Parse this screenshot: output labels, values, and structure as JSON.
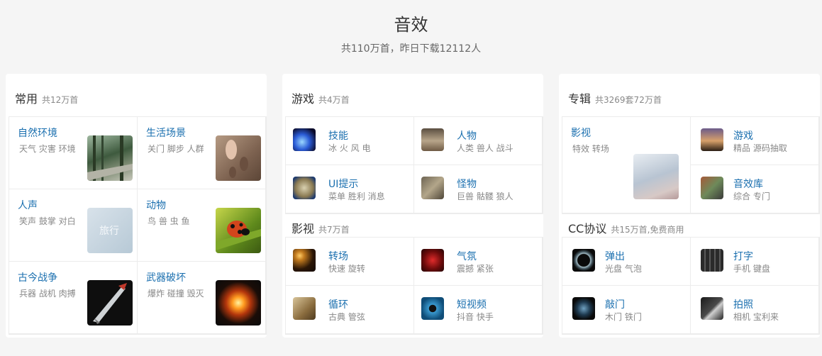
{
  "header": {
    "title": "音效",
    "subtitle": "共110万首，昨日下载12112人"
  },
  "panels": {
    "common": {
      "title": "常用",
      "count": "共12万首",
      "items": [
        {
          "title": "自然环境",
          "sub": "天气 灾害 环境",
          "icon": "forest-bridge-thumb"
        },
        {
          "title": "生活场景",
          "sub": "关门 脚步 人群",
          "icon": "footprints-sand-thumb"
        },
        {
          "title": "人声",
          "sub": "笑声 鼓掌 对白",
          "icon": "travel-thumb",
          "thumb_text": "旅行"
        },
        {
          "title": "动物",
          "sub": "鸟 兽 虫 鱼",
          "icon": "ladybug-thumb"
        },
        {
          "title": "古今战争",
          "sub": "兵器 战机 肉搏",
          "icon": "sword-thumb"
        },
        {
          "title": "武器破坏",
          "sub": "爆炸 碰撞 毁灭",
          "icon": "explosion-thumb"
        }
      ]
    },
    "game": {
      "title": "游戏",
      "count": "共4万首",
      "items": [
        {
          "title": "技能",
          "sub": "冰 火 风 电",
          "icon": "skill-icon"
        },
        {
          "title": "人物",
          "sub": "人类 兽人 战斗",
          "icon": "character-icon"
        },
        {
          "title": "UI提示",
          "sub": "菜单 胜利 消息",
          "icon": "ui-prompt-icon"
        },
        {
          "title": "怪物",
          "sub": "巨兽 骷髅 狼人",
          "icon": "monster-icon"
        }
      ]
    },
    "film": {
      "title": "影视",
      "count": "共7万首",
      "items": [
        {
          "title": "转场",
          "sub": "快速 旋转",
          "icon": "transition-icon"
        },
        {
          "title": "气氛",
          "sub": "震撼 紧张",
          "icon": "atmosphere-icon"
        },
        {
          "title": "循环",
          "sub": "古典 管弦",
          "icon": "loop-icon"
        },
        {
          "title": "短视频",
          "sub": "抖音 快手",
          "icon": "short-video-icon"
        }
      ]
    },
    "album": {
      "title": "专辑",
      "count": "共3269套72万首",
      "items": [
        {
          "title": "影视",
          "sub": "特效 转场",
          "icon": "film-album-thumb"
        },
        {
          "title": "游戏",
          "sub": "精品 源码抽取",
          "icon": "game-album-icon"
        },
        {
          "title": "音效库",
          "sub": "综合 专门",
          "icon": "library-icon"
        }
      ]
    },
    "cc": {
      "title": "CC协议",
      "count": "共15万首,免费商用",
      "items": [
        {
          "title": "弹出",
          "sub": "光盘 气泡",
          "icon": "popup-icon"
        },
        {
          "title": "打字",
          "sub": "手机 键盘",
          "icon": "typing-icon"
        },
        {
          "title": "敲门",
          "sub": "木门 铁门",
          "icon": "knock-icon"
        },
        {
          "title": "拍照",
          "sub": "相机 宝利来",
          "icon": "camera-icon"
        }
      ]
    }
  }
}
